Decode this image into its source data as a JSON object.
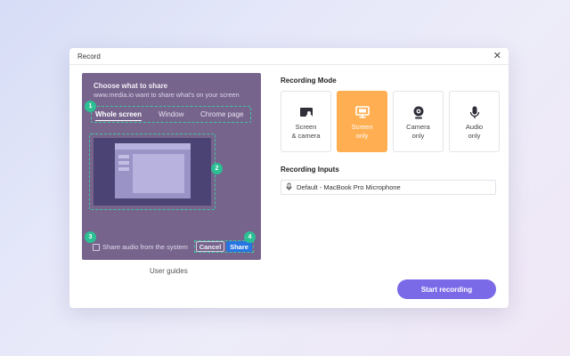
{
  "dialog": {
    "title": "Record",
    "close_glyph": "✕"
  },
  "picker": {
    "heading": "Choose what to share",
    "subtitle": "www.media.io want to share what's on your screen",
    "tabs": [
      {
        "label": "Whole screen",
        "active": true
      },
      {
        "label": "Window",
        "active": false
      },
      {
        "label": "Chrome page",
        "active": false
      }
    ],
    "badges": [
      "1",
      "2",
      "3",
      "4"
    ],
    "audio_label": "Share audio from the system",
    "cancel_label": "Cancel",
    "share_label": "Share"
  },
  "user_guides": "User guides",
  "recording_mode": {
    "title": "Recording Mode",
    "modes": [
      {
        "line1": "Screen",
        "line2": "& camera",
        "icon": "screen-camera-icon",
        "selected": false
      },
      {
        "line1": "Screen",
        "line2": "only",
        "icon": "monitor-icon",
        "selected": true
      },
      {
        "line1": "Camera",
        "line2": "only",
        "icon": "webcam-icon",
        "selected": false
      },
      {
        "line1": "Audio",
        "line2": "only",
        "icon": "microphone-icon",
        "selected": false
      }
    ]
  },
  "recording_inputs": {
    "title": "Recording Inputs",
    "microphone": "Default - MacBook Pro Microphone",
    "icon": "microphone-icon"
  },
  "start_button": "Start recording",
  "colors": {
    "accent": "#7b6ae8",
    "selected_mode": "#ffaf52",
    "badge": "#2bbf93",
    "share": "#2775e0",
    "picker_bg": "#76648c"
  }
}
